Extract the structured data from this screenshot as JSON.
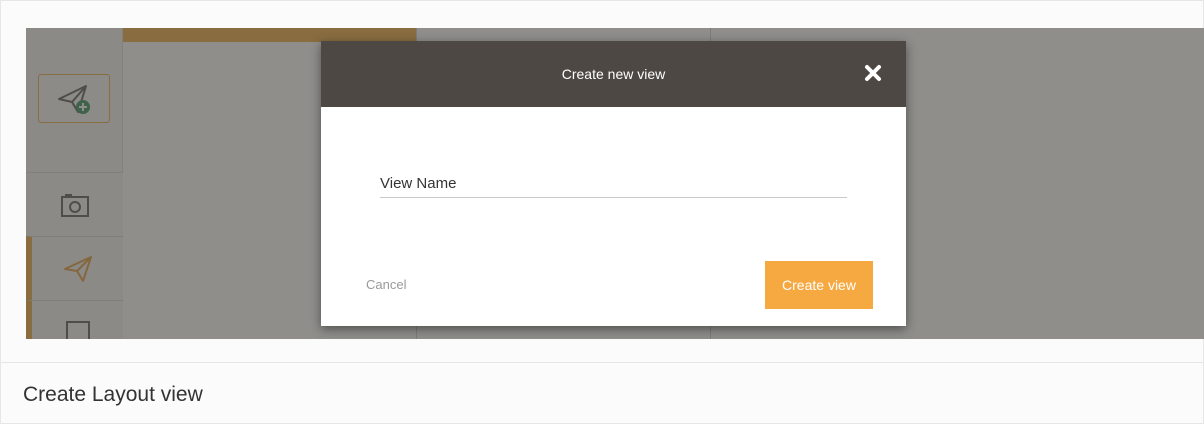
{
  "dialog": {
    "title": "Create new view",
    "field_placeholder": "View Name",
    "field_value": "",
    "cancel_label": "Cancel",
    "create_label": "Create view"
  },
  "caption": "Create Layout view",
  "icons": {
    "new_view": "send-plus-icon",
    "camera": "camera-icon",
    "send": "send-icon",
    "square": "square-icon",
    "close": "close-icon"
  },
  "colors": {
    "accent": "#f6a941",
    "header": "#4d4843",
    "overlay": "rgba(75,72,68,0.62)"
  }
}
